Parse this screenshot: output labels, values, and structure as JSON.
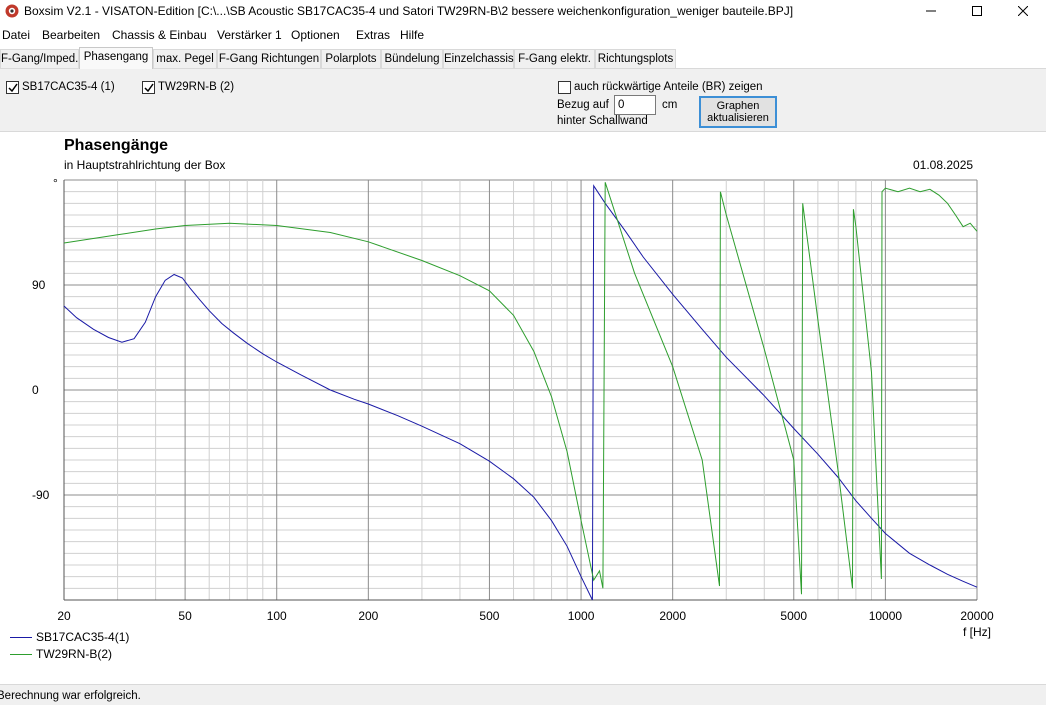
{
  "window": {
    "title": "Boxsim V2.1 - VISATON-Edition [C:\\...\\SB Acoustic SB17CAC35-4 und Satori TW29RN-B\\2 bessere weichenkonfiguration_weniger bauteile.BPJ]",
    "minimize_icon": "minimize-icon",
    "maximize_icon": "maximize-icon",
    "close_icon": "close-icon"
  },
  "menu": [
    "Datei",
    "Bearbeiten",
    "Chassis & Einbau",
    "Verstärker 1",
    "Optionen",
    "Extras",
    "Hilfe"
  ],
  "tabs": [
    "F-Gang/Imped.",
    "Phasengang",
    "max. Pegel",
    "F-Gang Richtungen",
    "Polarplots",
    "Bündelung",
    "Einzelchassis",
    "F-Gang elektr.",
    "Richtungsplots"
  ],
  "active_tab": "Phasengang",
  "options": {
    "driver1_label": "SB17CAC35-4 (1)",
    "driver1_checked": true,
    "driver2_label": "TW29RN-B (2)",
    "driver2_checked": true,
    "backward_label": "auch rückwärtige Anteile (BR) zeigen",
    "backward_checked": false,
    "reference_label": "Bezug auf",
    "reference_value": "0",
    "reference_unit": "cm",
    "reference_label2": "hinter Schallwand",
    "update_button_line1": "Graphen",
    "update_button_line2": "aktualisieren"
  },
  "chart_data": {
    "type": "line",
    "title": "Phasengänge",
    "subtitle": "in Hauptstrahlrichtung der Box",
    "date": "01.08.2025",
    "ylabel": "°",
    "xlabel": "f [Hz]",
    "x_scale": "log",
    "xlim": [
      20,
      20000
    ],
    "ylim": [
      -180,
      180
    ],
    "grid": true,
    "y_ticks": [
      90,
      0,
      -90
    ],
    "x_ticks": [
      20,
      50,
      100,
      200,
      500,
      1000,
      2000,
      5000,
      10000,
      20000
    ],
    "x_tick_labels": [
      "20",
      "50",
      "100",
      "200",
      "500",
      "1000",
      "2000",
      "5000",
      "10000",
      "20000"
    ],
    "legend_position": "bottom-left",
    "series": [
      {
        "name": "SB17CAC35-4(1)",
        "color": "#1a1aa6",
        "x": [
          20,
          22,
          25,
          28,
          31,
          34,
          37,
          40,
          43,
          46,
          49,
          52,
          56,
          60,
          66,
          72,
          80,
          90,
          100,
          120,
          150,
          180,
          200,
          250,
          300,
          400,
          500,
          600,
          700,
          800,
          900,
          1000,
          1090,
          1100,
          1120,
          1200,
          1400,
          1600,
          2000,
          2500,
          3000,
          4000,
          5000,
          6000,
          7000,
          8000,
          9000,
          10000,
          12000,
          14000,
          16000,
          18000,
          20000
        ],
        "values": [
          72,
          62,
          52,
          45,
          41,
          44,
          58,
          80,
          94,
          99,
          96,
          87,
          77,
          68,
          57,
          49,
          40,
          31,
          24,
          13,
          0,
          -8,
          -12,
          -22,
          -31,
          -46,
          -61,
          -76,
          -92,
          -112,
          -134,
          -160,
          -180,
          175,
          172,
          160,
          136,
          114,
          82,
          52,
          28,
          -5,
          -33,
          -55,
          -75,
          -95,
          -110,
          -123,
          -140,
          -150,
          -158,
          -164,
          -169
        ]
      },
      {
        "name": "TW29RN-B(2)",
        "color": "#2e9e2e",
        "x": [
          20,
          30,
          40,
          50,
          70,
          100,
          150,
          200,
          300,
          400,
          500,
          600,
          700,
          800,
          900,
          1000,
          1100,
          1150,
          1180,
          1200,
          1500,
          2000,
          2500,
          2850,
          2870,
          3000,
          4000,
          5000,
          5300,
          5350,
          6000,
          7000,
          7800,
          7850,
          8000,
          9000,
          9700,
          9750,
          10000,
          11000,
          12000,
          13000,
          14000,
          15000,
          16000,
          17000,
          18000,
          19000,
          20000
        ],
        "values": [
          126,
          133,
          138,
          141,
          143,
          141,
          135,
          127,
          111,
          98,
          85,
          64,
          33,
          -6,
          -53,
          -112,
          -163,
          -155,
          -170,
          178,
          100,
          20,
          -60,
          -168,
          170,
          150,
          35,
          -60,
          -175,
          160,
          60,
          -70,
          -170,
          155,
          140,
          15,
          -162,
          170,
          173,
          170,
          173,
          170,
          172,
          167,
          160,
          150,
          140,
          143,
          136
        ]
      }
    ]
  },
  "status": "Berechnung war erfolgreich."
}
